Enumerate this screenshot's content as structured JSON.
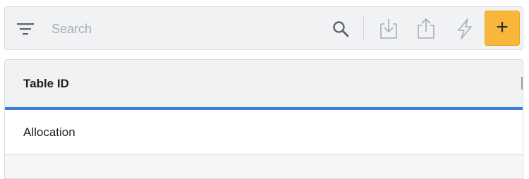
{
  "toolbar": {
    "filter_icon": "filter-icon",
    "search": {
      "placeholder": "Search",
      "value": ""
    },
    "icons": [
      "search-icon",
      "download-icon",
      "upload-icon",
      "flash-icon"
    ],
    "add_button": {
      "label": "+",
      "color": "#f8b73a"
    }
  },
  "table": {
    "columns": [
      "Table ID"
    ],
    "rows": [
      [
        "Allocation"
      ]
    ],
    "accent_color": "#3a7fd5"
  }
}
